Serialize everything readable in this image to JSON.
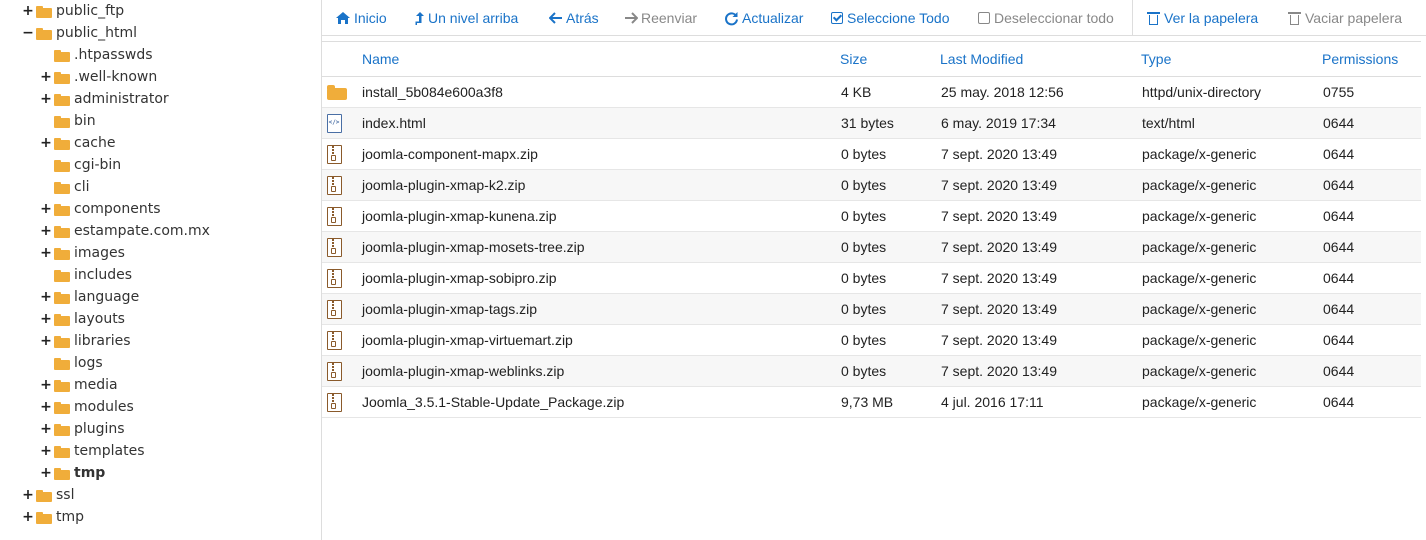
{
  "tree": [
    {
      "label": "public_ftp",
      "depth": 0,
      "toggle": "+",
      "bold": false
    },
    {
      "label": "public_html",
      "depth": 0,
      "toggle": "−",
      "bold": false
    },
    {
      "label": ".htpasswds",
      "depth": 1,
      "toggle": "",
      "bold": false
    },
    {
      "label": ".well-known",
      "depth": 1,
      "toggle": "+",
      "bold": false
    },
    {
      "label": "administrator",
      "depth": 1,
      "toggle": "+",
      "bold": false
    },
    {
      "label": "bin",
      "depth": 1,
      "toggle": "",
      "bold": false
    },
    {
      "label": "cache",
      "depth": 1,
      "toggle": "+",
      "bold": false
    },
    {
      "label": "cgi-bin",
      "depth": 1,
      "toggle": "",
      "bold": false
    },
    {
      "label": "cli",
      "depth": 1,
      "toggle": "",
      "bold": false
    },
    {
      "label": "components",
      "depth": 1,
      "toggle": "+",
      "bold": false
    },
    {
      "label": "estampate.com.mx",
      "depth": 1,
      "toggle": "+",
      "bold": false
    },
    {
      "label": "images",
      "depth": 1,
      "toggle": "+",
      "bold": false
    },
    {
      "label": "includes",
      "depth": 1,
      "toggle": "",
      "bold": false
    },
    {
      "label": "language",
      "depth": 1,
      "toggle": "+",
      "bold": false
    },
    {
      "label": "layouts",
      "depth": 1,
      "toggle": "+",
      "bold": false
    },
    {
      "label": "libraries",
      "depth": 1,
      "toggle": "+",
      "bold": false
    },
    {
      "label": "logs",
      "depth": 1,
      "toggle": "",
      "bold": false
    },
    {
      "label": "media",
      "depth": 1,
      "toggle": "+",
      "bold": false
    },
    {
      "label": "modules",
      "depth": 1,
      "toggle": "+",
      "bold": false
    },
    {
      "label": "plugins",
      "depth": 1,
      "toggle": "+",
      "bold": false
    },
    {
      "label": "templates",
      "depth": 1,
      "toggle": "+",
      "bold": false
    },
    {
      "label": "tmp",
      "depth": 1,
      "toggle": "+",
      "bold": true
    },
    {
      "label": "ssl",
      "depth": 0,
      "toggle": "+",
      "bold": false
    },
    {
      "label": "tmp",
      "depth": 0,
      "toggle": "+",
      "bold": false
    }
  ],
  "toolbar": {
    "home": "Inicio",
    "up": "Un nivel arriba",
    "back": "Atrás",
    "forward": "Reenviar",
    "reload": "Actualizar",
    "select_all": "Seleccione Todo",
    "deselect_all": "Deseleccionar todo",
    "view_trash": "Ver la papelera",
    "empty_trash": "Vaciar papelera"
  },
  "table": {
    "headers": {
      "name": "Name",
      "size": "Size",
      "modified": "Last Modified",
      "type": "Type",
      "permissions": "Permissions"
    },
    "rows": [
      {
        "icon": "folder",
        "name": "install_5b084e600a3f8",
        "size": "4 KB",
        "modified": "25 may. 2018 12:56",
        "type": "httpd/unix-directory",
        "perm": "0755"
      },
      {
        "icon": "code",
        "name": "index.html",
        "size": "31 bytes",
        "modified": "6 may. 2019 17:34",
        "type": "text/html",
        "perm": "0644"
      },
      {
        "icon": "zip",
        "name": "joomla-component-mapx.zip",
        "size": "0 bytes",
        "modified": "7 sept. 2020 13:49",
        "type": "package/x-generic",
        "perm": "0644"
      },
      {
        "icon": "zip",
        "name": "joomla-plugin-xmap-k2.zip",
        "size": "0 bytes",
        "modified": "7 sept. 2020 13:49",
        "type": "package/x-generic",
        "perm": "0644"
      },
      {
        "icon": "zip",
        "name": "joomla-plugin-xmap-kunena.zip",
        "size": "0 bytes",
        "modified": "7 sept. 2020 13:49",
        "type": "package/x-generic",
        "perm": "0644"
      },
      {
        "icon": "zip",
        "name": "joomla-plugin-xmap-mosets-tree.zip",
        "size": "0 bytes",
        "modified": "7 sept. 2020 13:49",
        "type": "package/x-generic",
        "perm": "0644"
      },
      {
        "icon": "zip",
        "name": "joomla-plugin-xmap-sobipro.zip",
        "size": "0 bytes",
        "modified": "7 sept. 2020 13:49",
        "type": "package/x-generic",
        "perm": "0644"
      },
      {
        "icon": "zip",
        "name": "joomla-plugin-xmap-tags.zip",
        "size": "0 bytes",
        "modified": "7 sept. 2020 13:49",
        "type": "package/x-generic",
        "perm": "0644"
      },
      {
        "icon": "zip",
        "name": "joomla-plugin-xmap-virtuemart.zip",
        "size": "0 bytes",
        "modified": "7 sept. 2020 13:49",
        "type": "package/x-generic",
        "perm": "0644"
      },
      {
        "icon": "zip",
        "name": "joomla-plugin-xmap-weblinks.zip",
        "size": "0 bytes",
        "modified": "7 sept. 2020 13:49",
        "type": "package/x-generic",
        "perm": "0644"
      },
      {
        "icon": "zip",
        "name": "Joomla_3.5.1-Stable-Update_Package.zip",
        "size": "9,73 MB",
        "modified": "4 jul. 2016 17:11",
        "type": "package/x-generic",
        "perm": "0644"
      }
    ]
  },
  "colors": {
    "link": "#1a73c8",
    "disabled": "#888888",
    "folder": "#f0ad3a",
    "zip": "#8a5a2b",
    "html": "#4a6fa5"
  }
}
